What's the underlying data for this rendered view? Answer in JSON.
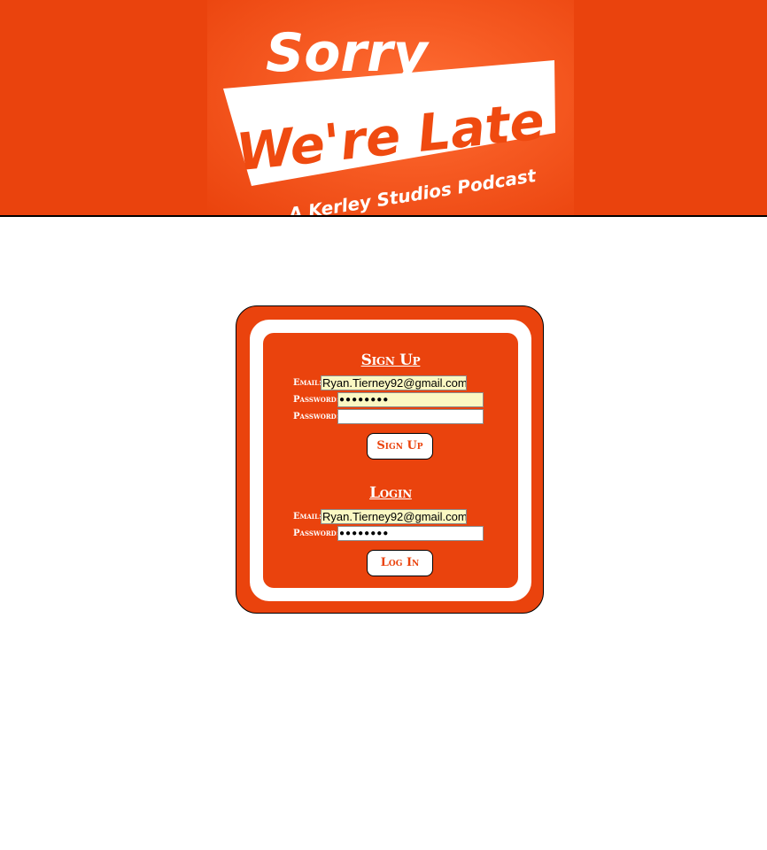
{
  "theme": {
    "accent": "#ea430d",
    "autofill_bg": "#fbf8c3",
    "button_text": "#ea430d"
  },
  "header": {
    "logo": {
      "line1": "Sorry",
      "line2": "We're Late",
      "line3": "A Kerley Studios Podcast"
    }
  },
  "signup": {
    "title": "Sign Up",
    "email_label": "Email:",
    "email_value": "Ryan.Tierney92@gmail.com",
    "password_label": "Password:",
    "password_value": "●●●●●●●●",
    "confirm_label": "Password:",
    "confirm_value": "",
    "button_label": "Sign Up"
  },
  "login": {
    "title": "Login",
    "email_label": "Email:",
    "email_value": "Ryan.Tierney92@gmail.com",
    "password_label": "Password:",
    "password_value": "●●●●●●●●",
    "button_label": "Log In"
  }
}
